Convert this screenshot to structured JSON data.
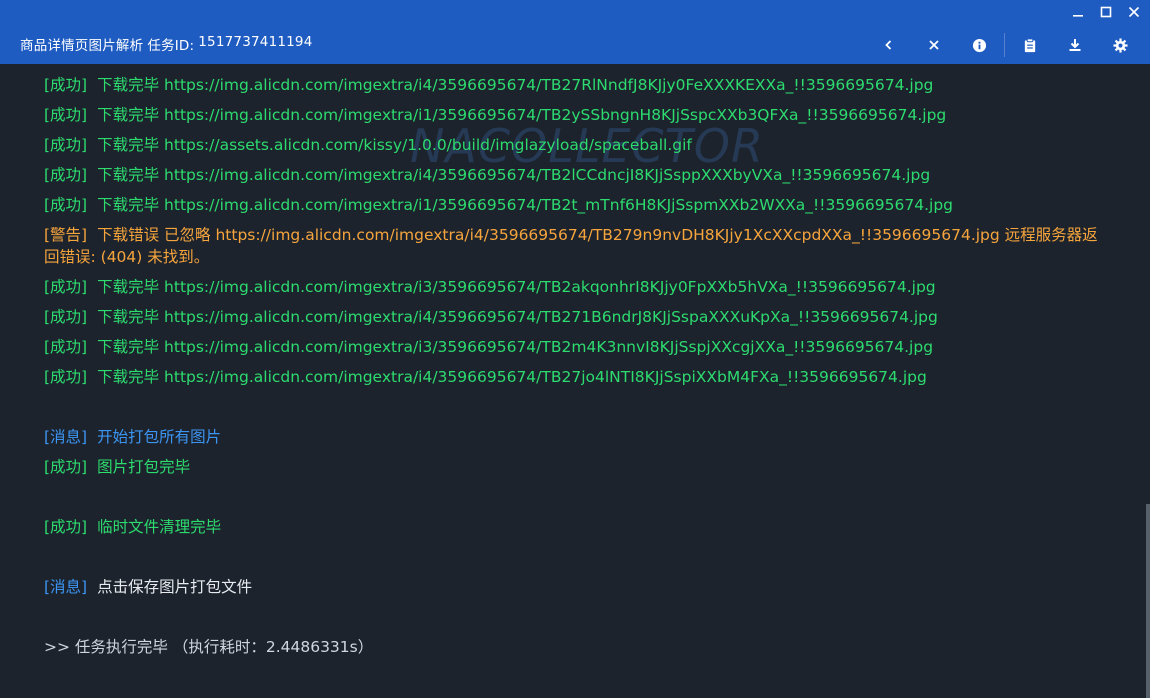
{
  "window": {
    "title": "商品详情页图片解析",
    "task_label": "任务ID:",
    "task_id": "1517737411194"
  },
  "system_controls": {
    "minimize": "—",
    "maximize": "☐",
    "close": "✕"
  },
  "toolbar": {
    "icons": [
      "chevron-left-icon",
      "close-icon",
      "info-icon",
      "clipboard-icon",
      "download-icon",
      "gear-icon"
    ]
  },
  "log": {
    "lines": [
      {
        "tag": "[成功]",
        "text": "下载完毕 https://img.alicdn.com/imgextra/i4/3596695674/TB27RlNndfJ8KJjy0FeXXXKEXXa_!!3596695674.jpg"
      },
      {
        "tag": "[成功]",
        "text": "下载完毕 https://img.alicdn.com/imgextra/i1/3596695674/TB2ySSbngnH8KJjSspcXXb3QFXa_!!3596695674.jpg"
      },
      {
        "tag": "[成功]",
        "text": "下载完毕 https://assets.alicdn.com/kissy/1.0.0/build/imglazyload/spaceball.gif"
      },
      {
        "tag": "[成功]",
        "text": "下载完毕 https://img.alicdn.com/imgextra/i4/3596695674/TB2lCCdncjI8KJjSsppXXXbyVXa_!!3596695674.jpg"
      },
      {
        "tag": "[成功]",
        "text": "下载完毕 https://img.alicdn.com/imgextra/i1/3596695674/TB2t_mTnf6H8KJjSspmXXb2WXXa_!!3596695674.jpg"
      },
      {
        "tag": "[警告]",
        "text": "下载错误 已忽略 https://img.alicdn.com/imgextra/i4/3596695674/TB279n9nvDH8KJjy1XcXXcpdXXa_!!3596695674.jpg 远程服务器返回错误: (404) 未找到。"
      },
      {
        "tag": "[成功]",
        "text": "下载完毕 https://img.alicdn.com/imgextra/i3/3596695674/TB2akqonhrI8KJjy0FpXXb5hVXa_!!3596695674.jpg"
      },
      {
        "tag": "[成功]",
        "text": "下载完毕 https://img.alicdn.com/imgextra/i4/3596695674/TB271B6ndrJ8KJjSspaXXXuKpXa_!!3596695674.jpg"
      },
      {
        "tag": "[成功]",
        "text": "下载完毕 https://img.alicdn.com/imgextra/i3/3596695674/TB2m4K3nnvI8KJjSspjXXcgjXXa_!!3596695674.jpg"
      },
      {
        "tag": "[成功]",
        "text": "下载完毕 https://img.alicdn.com/imgextra/i4/3596695674/TB27jo4lNTI8KJjSspiXXbM4FXa_!!3596695674.jpg"
      },
      {
        "tag": "[消息]",
        "text": "开始打包所有图片"
      },
      {
        "tag": "[成功]",
        "text": "图片打包完毕"
      },
      {
        "tag": "[成功]",
        "text": "临时文件清理完毕"
      },
      {
        "tag": "[消息]",
        "text": "点击保存图片打包文件"
      }
    ],
    "final": ">> 任务执行完毕 （执行耗时：2.4486331s）"
  },
  "colors": {
    "titlebar": "#1f5cc2",
    "background": "#1c232d",
    "success": "#2ddb6f",
    "warning": "#f6a43c",
    "info": "#3c95f2"
  }
}
